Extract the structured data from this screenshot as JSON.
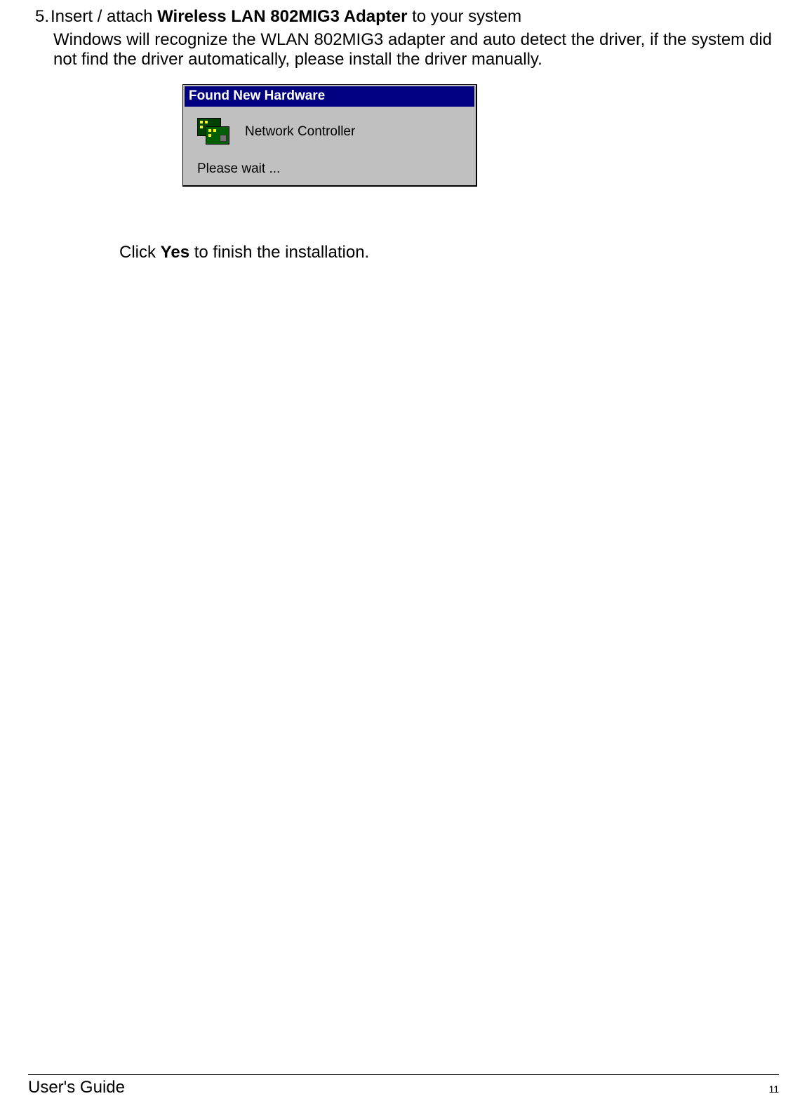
{
  "step": {
    "number": "5.",
    "prefix": "Insert / attach ",
    "bold_product": "Wireless LAN 802MIG3 Adapter",
    "suffix": " to your system"
  },
  "body_text": "Windows will recognize the WLAN 802MIG3 adapter and auto detect the driver, if the system did not find the driver automatically, please install the driver manually.",
  "dialog": {
    "title": "Found New Hardware",
    "device": "Network Controller",
    "wait": "Please wait ..."
  },
  "yes_line": {
    "prefix": "Click ",
    "bold": "Yes",
    "suffix": " to finish the installation."
  },
  "footer": {
    "title": "User's Guide",
    "page": "11"
  }
}
